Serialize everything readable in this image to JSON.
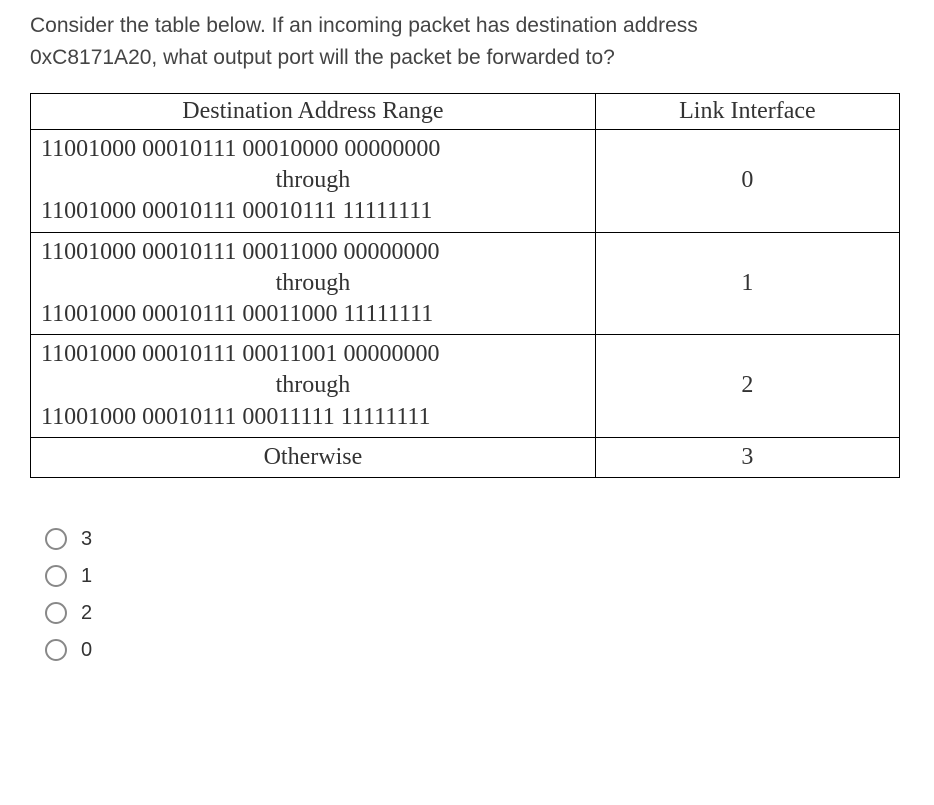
{
  "question": {
    "line1": "Consider the table below. If an incoming packet has destination address",
    "line2": "0xC8171A20, what output port will the packet be forwarded to?"
  },
  "table": {
    "headers": {
      "dest": "Destination Address Range",
      "link": "Link Interface"
    },
    "rows": [
      {
        "start": "11001000 00010111 00010000 00000000",
        "through": "through",
        "end": "11001000 00010111 00010111 11111111",
        "link": "0"
      },
      {
        "start": "11001000 00010111 00011000 00000000",
        "through": "through",
        "end": "11001000 00010111 00011000 11111111",
        "link": "1"
      },
      {
        "start": "11001000 00010111 00011001 00000000",
        "through": "through",
        "end": "11001000 00010111 00011111 11111111",
        "link": "2"
      },
      {
        "otherwise": "Otherwise",
        "link": "3"
      }
    ]
  },
  "options": [
    {
      "label": "3"
    },
    {
      "label": "1"
    },
    {
      "label": "2"
    },
    {
      "label": "0"
    }
  ]
}
